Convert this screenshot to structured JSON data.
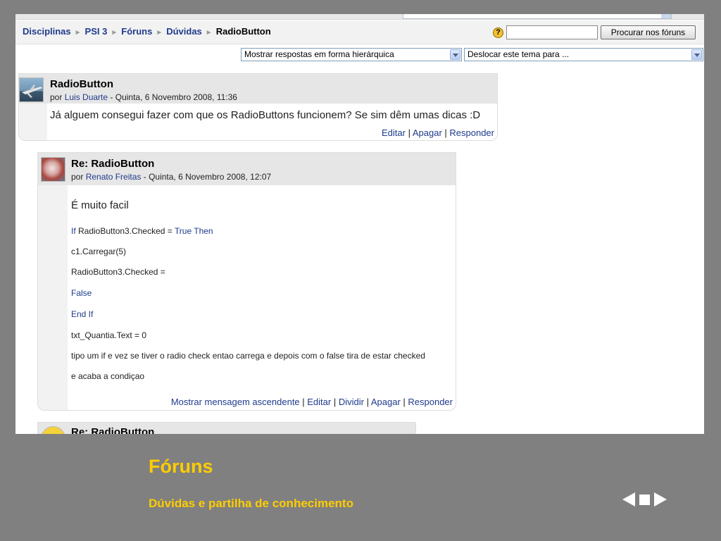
{
  "breadcrumb": {
    "items": [
      "Disciplinas",
      "PSI 3",
      "Fóruns",
      "Dúvidas"
    ],
    "current": "RadioButton",
    "separator": "►"
  },
  "search": {
    "button_label": "Procurar nos fóruns",
    "help_glyph": "?"
  },
  "controls": {
    "display_mode": "Mostrar respostas em forma hierárquica",
    "move_topic": "Deslocar este tema para ..."
  },
  "posts": [
    {
      "subject": "RadioButton",
      "by": "por",
      "author": "Luis Duarte",
      "date": "- Quinta, 6 Novembro 2008, 11:36",
      "message": "Já alguem consegui fazer com que os RadioButtons funcionem? Se sim dêm umas dicas :D",
      "commands": [
        "Editar",
        "Apagar",
        "Responder"
      ]
    },
    {
      "subject": "Re: RadioButton",
      "by": "por",
      "author": "Renato Freitas",
      "date": "- Quinta, 6 Novembro 2008, 12:07",
      "lines": {
        "l1": "É muito facil",
        "l2a": "If",
        "l2b": " RadioButton3.Checked = ",
        "l2c": "True Then",
        "l3": "c1.Carregar(5)",
        "l4": "RadioButton3.Checked =",
        "l5": "False",
        "l6": "End If",
        "l7": "txt_Quantia.Text = 0",
        "l8": "tipo um if e vez se tiver o radio check entao carrega e depois com o false tira de estar checked",
        "l9": "e acaba a condiçao"
      },
      "commands": [
        "Mostrar mensagem ascendente",
        "Editar",
        "Dividir",
        "Apagar",
        "Responder"
      ]
    },
    {
      "subject": "Re: RadioButton"
    }
  ],
  "footer": {
    "title": "Fóruns",
    "subtitle": "Dúvidas e partilha de conhecimento"
  },
  "colors": {
    "accent": "#ffcc00",
    "link": "#1f3b8c",
    "slide_bg": "#808080"
  }
}
